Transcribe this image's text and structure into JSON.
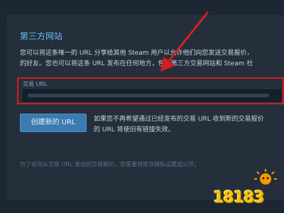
{
  "section": {
    "title": "第三方网站",
    "desc_line1": "您可以将这条唯一的 URL 分享给其他 Steam 用户以允许他们向您发送交易报价，",
    "desc_line2": "的好友。您也可以将这条 URL 发布在任何地方，包括第三方交易网站和 Steam 社"
  },
  "trade_url": {
    "label": "交易 URL",
    "value": ""
  },
  "create_button": {
    "label": "创建新的 URL"
  },
  "create_note": {
    "line1": "如果您不再希望通过已经发布的交易 URL 收到新的交易报价",
    "line2": "的 URL 将使旧有链接失效。"
  },
  "footnote": "为了收到从交易 URL 发出的交易报价，您需要将库存隐私设置成公开。",
  "watermark": {
    "text": "18183"
  },
  "colors": {
    "accent": "#67c1f5",
    "highlight_border": "#d21f1f",
    "button": "#3a7bb0",
    "watermark": "#f5c400"
  }
}
